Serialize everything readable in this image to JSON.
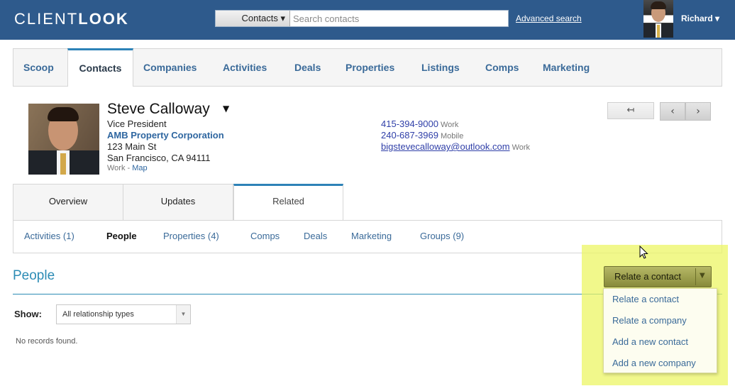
{
  "header": {
    "logo_part1": "CLIENT",
    "logo_part2": "LOOK",
    "search_type": "Contacts ▾",
    "search_placeholder": "Search contacts",
    "advanced_search": "Advanced search",
    "user_name": "Richard ▾"
  },
  "main_nav": {
    "tabs": [
      {
        "label": "Scoop"
      },
      {
        "label": "Contacts"
      },
      {
        "label": "Companies"
      },
      {
        "label": "Activities"
      },
      {
        "label": "Deals"
      },
      {
        "label": "Properties"
      },
      {
        "label": "Listings"
      },
      {
        "label": "Comps"
      },
      {
        "label": "Marketing"
      }
    ],
    "active": "Contacts"
  },
  "contact": {
    "name": "Steve Calloway",
    "title": "Vice President",
    "company": "AMB Property Corporation",
    "address1": "123 Main St",
    "address2": "San Francisco, CA 94111",
    "address_type": "Work - ",
    "map_link": "Map",
    "phones": [
      {
        "number": "415-394-9000",
        "label": "Work"
      },
      {
        "number": "240-687-3969",
        "label": "Mobile"
      }
    ],
    "email": {
      "address": "bigstevecalloway@outlook.com",
      "label": "Work"
    }
  },
  "nav_buttons": {
    "back": "↤",
    "prev": "‹",
    "next": "›"
  },
  "sub_tabs": [
    {
      "label": "Overview"
    },
    {
      "label": "Updates"
    },
    {
      "label": "Related"
    }
  ],
  "related_nav": [
    {
      "label": "Activities (1)"
    },
    {
      "label": "People"
    },
    {
      "label": "Properties (4)"
    },
    {
      "label": "Comps"
    },
    {
      "label": "Deals"
    },
    {
      "label": "Marketing"
    },
    {
      "label": "Groups (9)"
    }
  ],
  "section": {
    "title": "People",
    "show_label": "Show:",
    "filter_value": "All relationship types",
    "empty_text": "No records found."
  },
  "relate_button": {
    "label": "Relate a contact",
    "menu": [
      {
        "label": "Relate a contact"
      },
      {
        "label": "Relate a company"
      },
      {
        "label": "Add a new contact"
      },
      {
        "label": "Add a new company"
      }
    ]
  },
  "colors": {
    "header_bg": "#2e5a8c",
    "accent": "#2d82b7",
    "link": "#3a6a99",
    "highlight": "#ecf664"
  }
}
